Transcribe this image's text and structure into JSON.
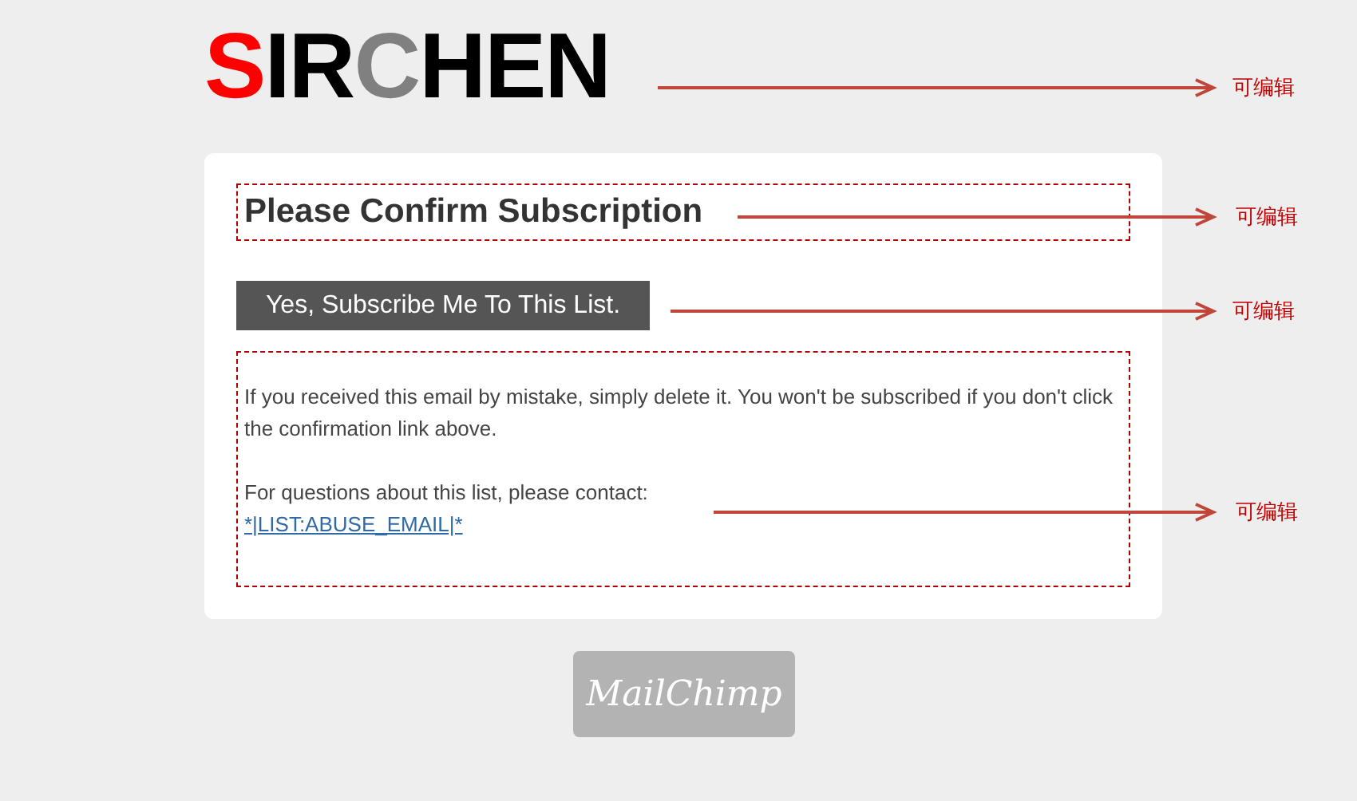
{
  "logo": {
    "parts": [
      {
        "text": "S",
        "color": "#ff0000"
      },
      {
        "text": "IR",
        "color": "#000000"
      },
      {
        "text": "C",
        "color": "#808080"
      },
      {
        "text": "HEN",
        "color": "#000000"
      }
    ]
  },
  "card": {
    "heading": "Please Confirm Subscription",
    "button": "Yes, Subscribe Me To This List.",
    "paragraphs": [
      "If you received this email by mistake, simply delete it. You won't be subscribed if you don't click the confirmation link above.",
      "For questions about this list, please contact:"
    ],
    "link": "*|LIST:ABUSE_EMAIL|*"
  },
  "badge": "MailChimp",
  "annotations": [
    {
      "label": "可编辑"
    },
    {
      "label": "可编辑"
    },
    {
      "label": "可编辑"
    },
    {
      "label": "可编辑"
    }
  ]
}
